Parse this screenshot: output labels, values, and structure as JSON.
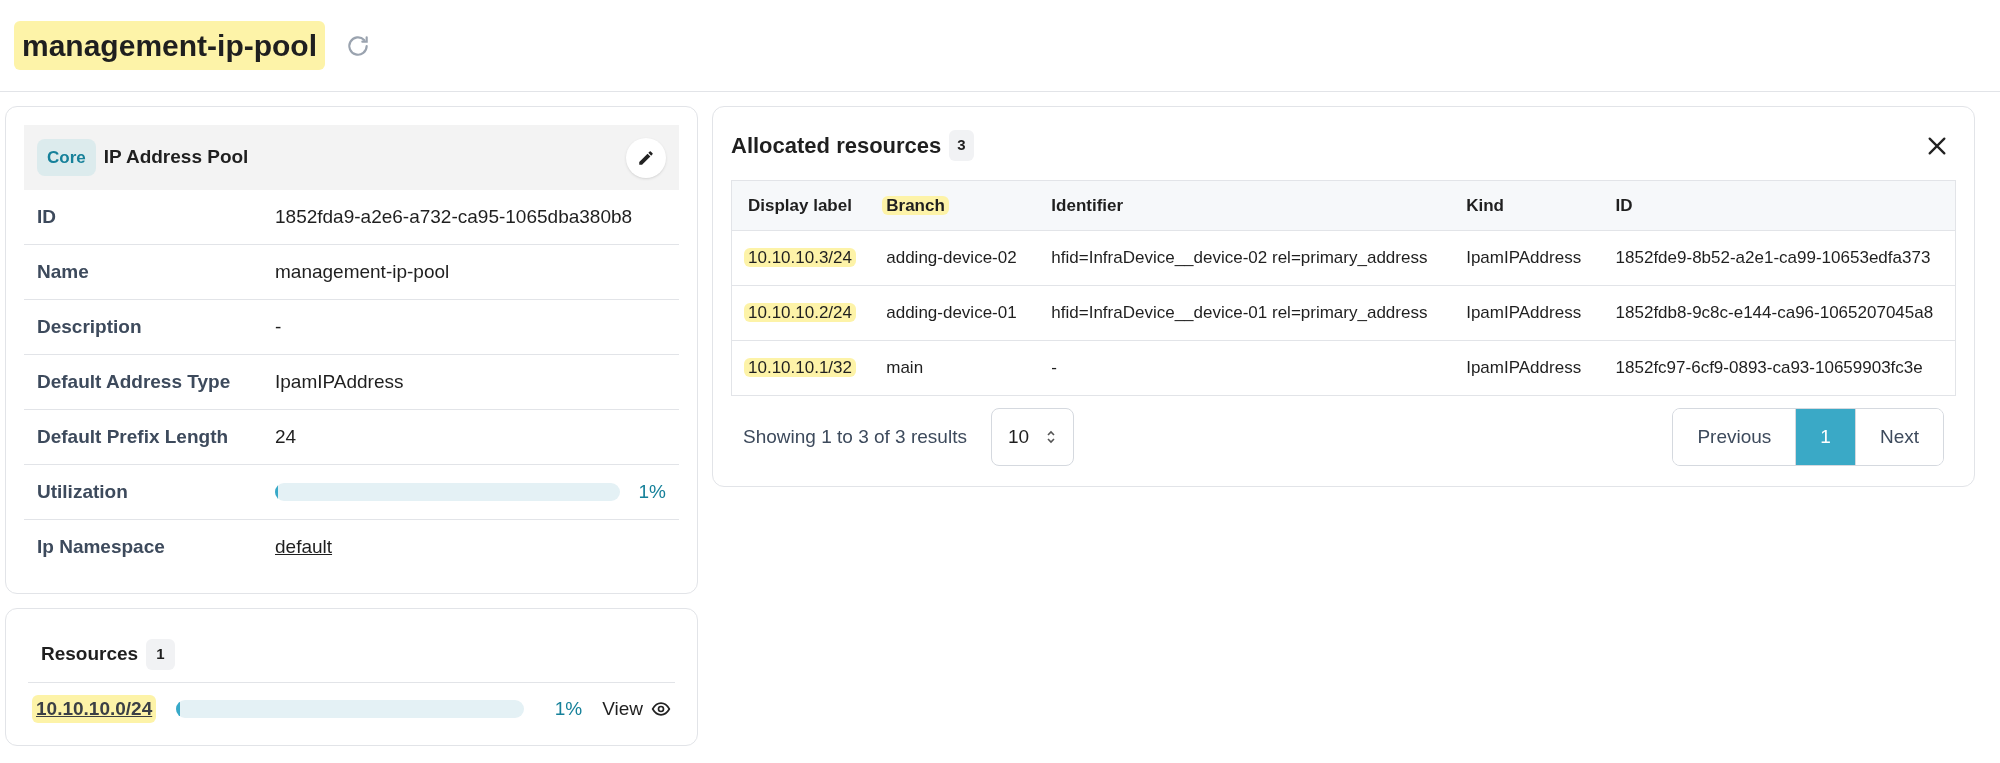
{
  "header": {
    "title": "management-ip-pool",
    "title_highlighted": true
  },
  "details": {
    "tag": "Core",
    "title": "IP Address Pool",
    "fields": [
      {
        "kind": "text",
        "label": "ID",
        "value": "1852fda9-a2e6-a732-ca95-1065dba380b8"
      },
      {
        "kind": "text",
        "label": "Name",
        "value": "management-ip-pool"
      },
      {
        "kind": "text",
        "label": "Description",
        "value": "-"
      },
      {
        "kind": "text",
        "label": "Default Address Type",
        "value": "IpamIPAddress"
      },
      {
        "kind": "text",
        "label": "Default Prefix Length",
        "value": "24"
      },
      {
        "kind": "meter",
        "label": "Utilization",
        "level": 0.01,
        "value": "1%"
      },
      {
        "kind": "link",
        "label": "Ip Namespace",
        "value": "default"
      }
    ]
  },
  "resources": {
    "title": "Resources",
    "count": "1",
    "items": [
      {
        "address": "10.10.10.0/24",
        "highlighted": true,
        "level": 0.01,
        "reading": "1%",
        "action": "View"
      }
    ]
  },
  "allocated": {
    "title": "Allocated resources",
    "count": "3",
    "columns": [
      {
        "label": "Display label",
        "highlighted": false
      },
      {
        "label": "Branch",
        "highlighted": true
      },
      {
        "label": "Identifier",
        "highlighted": false
      },
      {
        "label": "Kind",
        "highlighted": false
      },
      {
        "label": "ID",
        "highlighted": false
      }
    ],
    "rows": [
      {
        "cells": [
          {
            "text": "10.10.10.3/24",
            "highlighted": true
          },
          {
            "text": "adding-device-02",
            "highlighted": false
          },
          {
            "text": "hfid=InfraDevice__device-02 rel=primary_address",
            "highlighted": false
          },
          {
            "text": "IpamIPAddress",
            "highlighted": false
          },
          {
            "text": "1852fde9-8b52-a2e1-ca99-10653edfa373",
            "highlighted": false
          }
        ]
      },
      {
        "cells": [
          {
            "text": "10.10.10.2/24",
            "highlighted": true
          },
          {
            "text": "adding-device-01",
            "highlighted": false
          },
          {
            "text": "hfid=InfraDevice__device-01 rel=primary_address",
            "highlighted": false
          },
          {
            "text": "IpamIPAddress",
            "highlighted": false
          },
          {
            "text": "1852fdb8-9c8c-e144-ca96-1065207045a8",
            "highlighted": false
          }
        ]
      },
      {
        "cells": [
          {
            "text": "10.10.10.1/32",
            "highlighted": true
          },
          {
            "text": "main",
            "highlighted": false
          },
          {
            "text": "-",
            "highlighted": false
          },
          {
            "text": "IpamIPAddress",
            "highlighted": false
          },
          {
            "text": "1852fc97-6cf9-0893-ca93-10659903fc3e",
            "highlighted": false
          }
        ]
      }
    ],
    "summary": "Showing 1 to 3 of 3 results",
    "page_size": "10",
    "pages": [
      {
        "label": "Previous",
        "selected": false
      },
      {
        "label": "1",
        "selected": true
      },
      {
        "label": "Next",
        "selected": false
      }
    ]
  }
}
